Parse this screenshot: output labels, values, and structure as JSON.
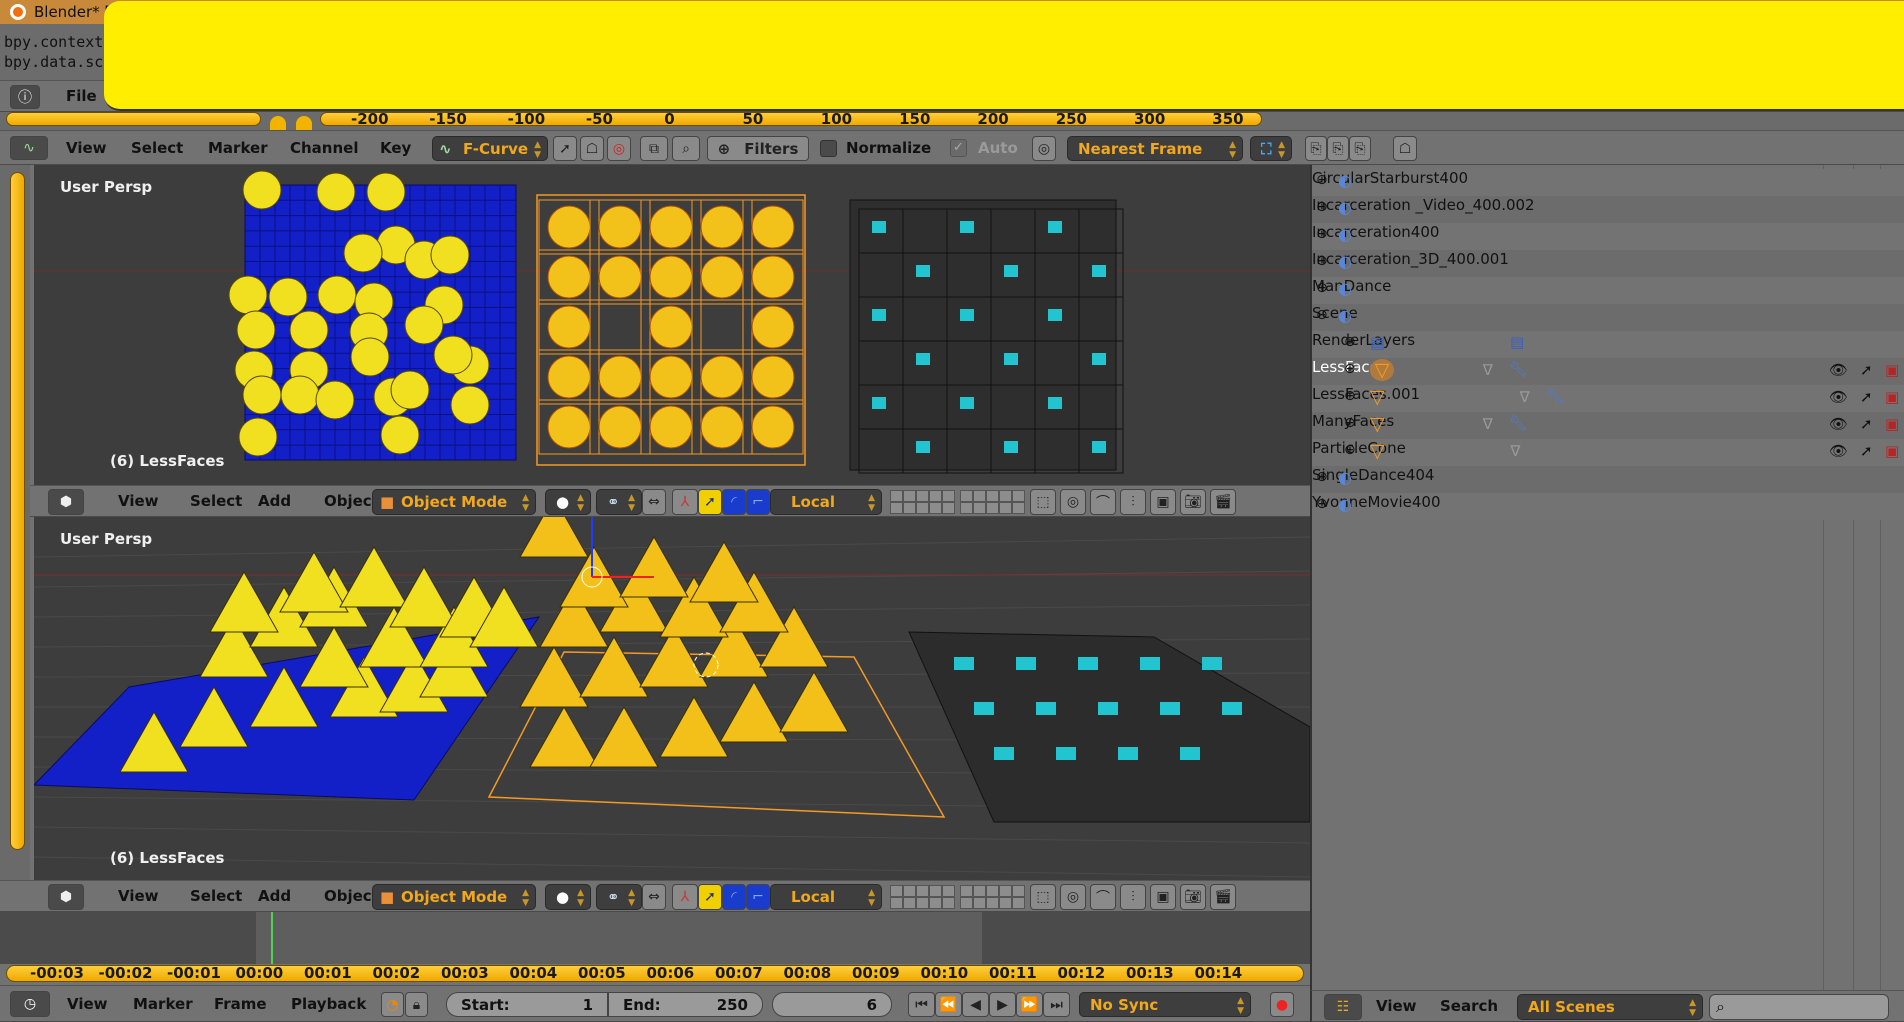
{
  "window": {
    "title": "Blender* [",
    "title_bar_color": "#c8893a",
    "redaction_color": "#ffee00"
  },
  "console": {
    "lines": [
      "bpy.context",
      "bpy.data.sc"
    ]
  },
  "info_header": {
    "icon": "info-icon",
    "file_menu": "File"
  },
  "graph_ruler": {
    "ticks": [
      "-200",
      "-150",
      "-100",
      "-50",
      "0",
      "50",
      "100",
      "150",
      "200",
      "250",
      "300",
      "350"
    ]
  },
  "graph_header": {
    "editor_icon": "graph-editor-icon",
    "menus": [
      "View",
      "Select",
      "Marker",
      "Channel",
      "Key"
    ],
    "mode": "F-Curve",
    "filters": "Filters",
    "normalize": {
      "label": "Normalize",
      "checked": false
    },
    "auto": {
      "label": "Auto",
      "checked": true,
      "enabled": false
    },
    "snap": "Nearest Frame"
  },
  "viewports": [
    {
      "view_label": "User Persp",
      "object_label": "(6) LessFaces"
    },
    {
      "view_label": "User Persp",
      "object_label": "(6) LessFaces"
    }
  ],
  "view3d_header": {
    "menus": [
      "View",
      "Select",
      "Add",
      "Object"
    ],
    "mode": "Object Mode",
    "orientation": "Local"
  },
  "outliner": {
    "items": [
      {
        "label": "CircularStarburst400",
        "type": "scene",
        "expanded": false,
        "level": 0
      },
      {
        "label": "Incarceration _Video_400.002",
        "type": "scene",
        "expanded": false,
        "level": 0
      },
      {
        "label": "Incarceration400",
        "type": "scene",
        "expanded": false,
        "level": 0
      },
      {
        "label": "Incarceration_3D_400.001",
        "type": "scene",
        "expanded": false,
        "level": 0
      },
      {
        "label": "ManDance",
        "type": "scene",
        "expanded": false,
        "level": 0
      },
      {
        "label": "Scene",
        "type": "scene",
        "expanded": true,
        "level": 0
      },
      {
        "label": "RenderLayers",
        "type": "renderlayers",
        "expanded": false,
        "level": 1
      },
      {
        "label": "LessFaces",
        "type": "mesh",
        "expanded": false,
        "level": 1,
        "active": true,
        "modifier": true
      },
      {
        "label": "LessFaces.001",
        "type": "mesh",
        "expanded": false,
        "level": 1,
        "modifier": true
      },
      {
        "label": "ManyFaces",
        "type": "mesh",
        "expanded": false,
        "level": 1,
        "modifier": true
      },
      {
        "label": "ParticleCone",
        "type": "mesh",
        "expanded": false,
        "level": 1,
        "modifier": false
      },
      {
        "label": "SingleDance404",
        "type": "scene",
        "expanded": false,
        "level": 0
      },
      {
        "label": "YvonneMovie400",
        "type": "scene",
        "expanded": false,
        "level": 0
      }
    ],
    "header": {
      "menus": [
        "View",
        "Search"
      ],
      "display_mode": "All Scenes",
      "search_placeholder": ""
    }
  },
  "timeline": {
    "ticks": [
      "-00:03",
      "-00:02",
      "-00:01",
      "00:00",
      "00:01",
      "00:02",
      "00:03",
      "00:04",
      "00:05",
      "00:06",
      "00:07",
      "00:08",
      "00:09",
      "00:10",
      "00:11",
      "00:12",
      "00:13",
      "00:14"
    ],
    "menus": [
      "View",
      "Marker",
      "Frame",
      "Playback"
    ],
    "start_label": "Start:",
    "start": "1",
    "end_label": "End:",
    "end": "250",
    "current_frame": "6",
    "sync": "No Sync"
  },
  "colors": {
    "accent": "#f2a81d",
    "viewport_bg": "#3d3d3d",
    "mesh_blue": "#1320c8",
    "cone_yellow": "#f0e020",
    "wire_orange": "#f39a25",
    "face_cyan": "#22c4d0"
  }
}
